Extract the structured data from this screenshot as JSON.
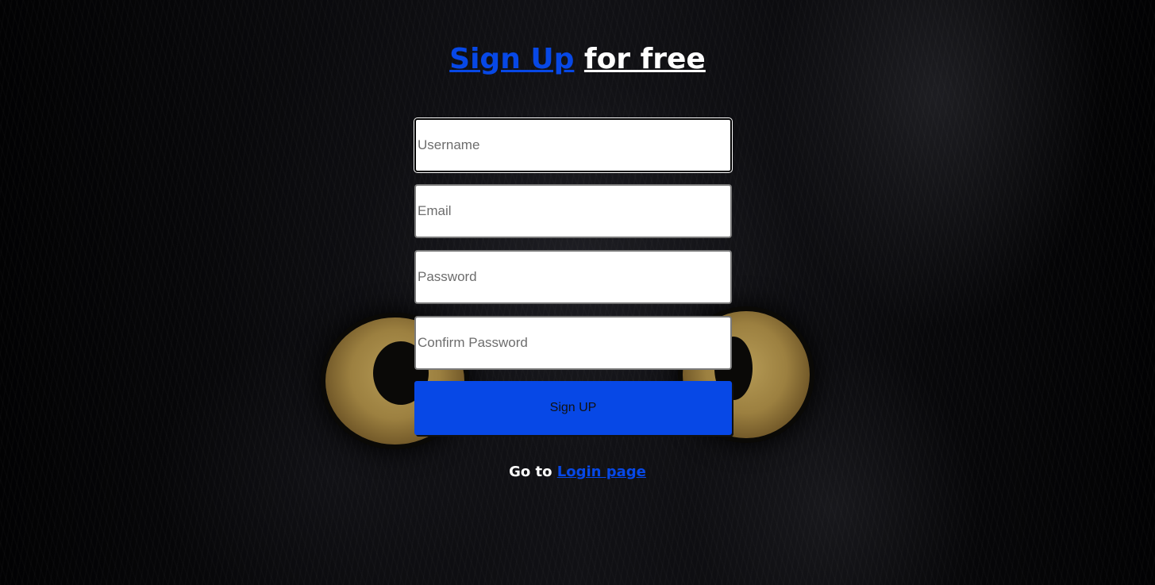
{
  "header": {
    "title_link": "Sign Up",
    "title_rest": "for free"
  },
  "form": {
    "username_placeholder": "Username",
    "email_placeholder": "Email",
    "password_placeholder": "Password",
    "confirm_placeholder": "Confirm Password",
    "submit_label": "Sign UP"
  },
  "footer": {
    "prefix": "Go to",
    "login_link": "Login page"
  },
  "colors": {
    "accent": "#0748e6",
    "text": "#ffffff",
    "background": "#050507"
  }
}
